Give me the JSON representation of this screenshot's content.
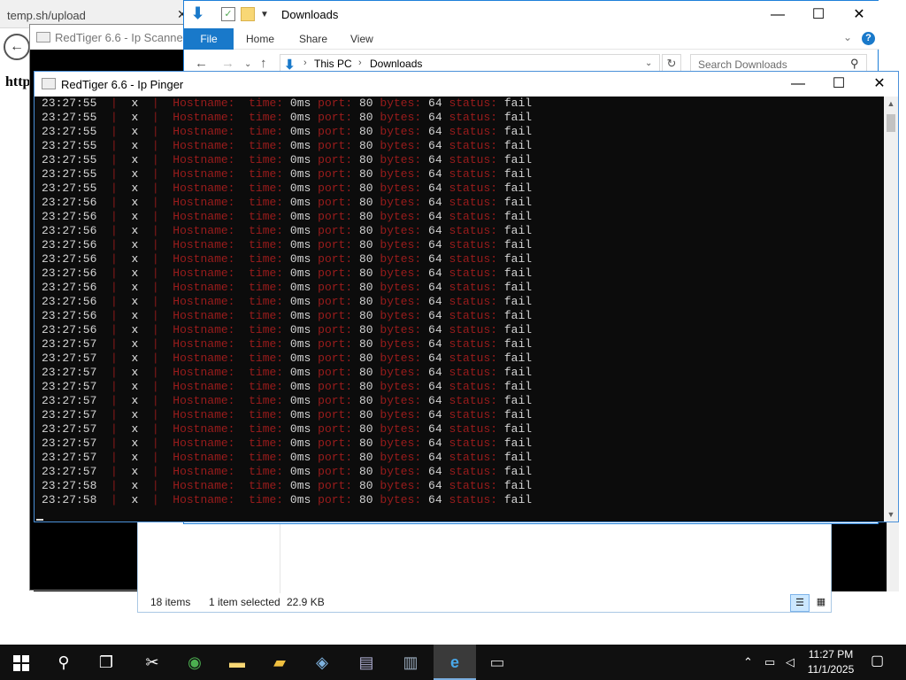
{
  "browser": {
    "tab_title": "temp.sh/upload",
    "url_fragment": "http"
  },
  "scanner": {
    "title": "RedTiger 6.6 - Ip Scanner"
  },
  "explorer": {
    "title": "Downloads",
    "ribbon": {
      "file": "File",
      "home": "Home",
      "share": "Share",
      "view": "View"
    },
    "address": {
      "this_pc": "This PC",
      "downloads": "Downloads"
    },
    "search_placeholder": "Search Downloads",
    "status": {
      "items": "18 items",
      "selected": "1 item selected",
      "size": "22.9 KB"
    }
  },
  "pinger": {
    "title": "RedTiger 6.6 - Ip Pinger",
    "labels": {
      "hostname": "Hostname:",
      "time": "time:",
      "port": "port:",
      "bytes": "bytes:",
      "status": "status:"
    },
    "mark": "x",
    "rows": [
      {
        "ts": "23:27:55",
        "time": "0ms",
        "port": "80",
        "bytes": "64",
        "status": "fail"
      },
      {
        "ts": "23:27:55",
        "time": "0ms",
        "port": "80",
        "bytes": "64",
        "status": "fail"
      },
      {
        "ts": "23:27:55",
        "time": "0ms",
        "port": "80",
        "bytes": "64",
        "status": "fail"
      },
      {
        "ts": "23:27:55",
        "time": "0ms",
        "port": "80",
        "bytes": "64",
        "status": "fail"
      },
      {
        "ts": "23:27:55",
        "time": "0ms",
        "port": "80",
        "bytes": "64",
        "status": "fail"
      },
      {
        "ts": "23:27:55",
        "time": "0ms",
        "port": "80",
        "bytes": "64",
        "status": "fail"
      },
      {
        "ts": "23:27:55",
        "time": "0ms",
        "port": "80",
        "bytes": "64",
        "status": "fail"
      },
      {
        "ts": "23:27:56",
        "time": "0ms",
        "port": "80",
        "bytes": "64",
        "status": "fail"
      },
      {
        "ts": "23:27:56",
        "time": "0ms",
        "port": "80",
        "bytes": "64",
        "status": "fail"
      },
      {
        "ts": "23:27:56",
        "time": "0ms",
        "port": "80",
        "bytes": "64",
        "status": "fail"
      },
      {
        "ts": "23:27:56",
        "time": "0ms",
        "port": "80",
        "bytes": "64",
        "status": "fail"
      },
      {
        "ts": "23:27:56",
        "time": "0ms",
        "port": "80",
        "bytes": "64",
        "status": "fail"
      },
      {
        "ts": "23:27:56",
        "time": "0ms",
        "port": "80",
        "bytes": "64",
        "status": "fail"
      },
      {
        "ts": "23:27:56",
        "time": "0ms",
        "port": "80",
        "bytes": "64",
        "status": "fail"
      },
      {
        "ts": "23:27:56",
        "time": "0ms",
        "port": "80",
        "bytes": "64",
        "status": "fail"
      },
      {
        "ts": "23:27:56",
        "time": "0ms",
        "port": "80",
        "bytes": "64",
        "status": "fail"
      },
      {
        "ts": "23:27:56",
        "time": "0ms",
        "port": "80",
        "bytes": "64",
        "status": "fail"
      },
      {
        "ts": "23:27:57",
        "time": "0ms",
        "port": "80",
        "bytes": "64",
        "status": "fail"
      },
      {
        "ts": "23:27:57",
        "time": "0ms",
        "port": "80",
        "bytes": "64",
        "status": "fail"
      },
      {
        "ts": "23:27:57",
        "time": "0ms",
        "port": "80",
        "bytes": "64",
        "status": "fail"
      },
      {
        "ts": "23:27:57",
        "time": "0ms",
        "port": "80",
        "bytes": "64",
        "status": "fail"
      },
      {
        "ts": "23:27:57",
        "time": "0ms",
        "port": "80",
        "bytes": "64",
        "status": "fail"
      },
      {
        "ts": "23:27:57",
        "time": "0ms",
        "port": "80",
        "bytes": "64",
        "status": "fail"
      },
      {
        "ts": "23:27:57",
        "time": "0ms",
        "port": "80",
        "bytes": "64",
        "status": "fail"
      },
      {
        "ts": "23:27:57",
        "time": "0ms",
        "port": "80",
        "bytes": "64",
        "status": "fail"
      },
      {
        "ts": "23:27:57",
        "time": "0ms",
        "port": "80",
        "bytes": "64",
        "status": "fail"
      },
      {
        "ts": "23:27:57",
        "time": "0ms",
        "port": "80",
        "bytes": "64",
        "status": "fail"
      },
      {
        "ts": "23:27:58",
        "time": "0ms",
        "port": "80",
        "bytes": "64",
        "status": "fail"
      },
      {
        "ts": "23:27:58",
        "time": "0ms",
        "port": "80",
        "bytes": "64",
        "status": "fail"
      }
    ]
  },
  "taskbar": {
    "time": "11:27 PM",
    "date": "11/1/2025"
  }
}
